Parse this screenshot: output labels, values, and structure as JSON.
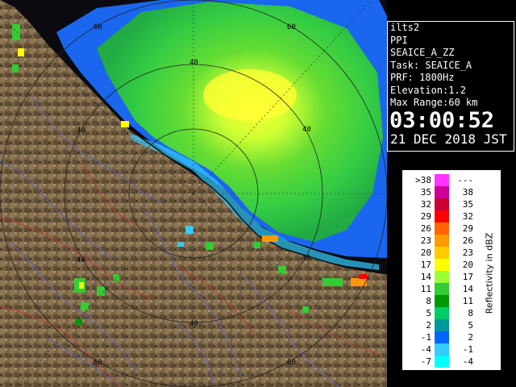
{
  "info": {
    "station": "ilts2",
    "mode": "PPI",
    "task_name": "SEAICE_A_ZZ",
    "task": "Task: SEAICE_A",
    "prf": "PRF: 1800Hz",
    "elevation": "Elevation:1.2",
    "max_range": "Max Range:60 km",
    "time": "03:00:52",
    "date": "21 DEC 2018 JST"
  },
  "range_ring_labels": {
    "r40": "40",
    "r60": "60"
  },
  "legend": {
    "title": "Reflectivity in dBZ",
    "bins": [
      {
        "lo": ">38",
        "hi": "---",
        "color": "#ff33ff"
      },
      {
        "lo": "35",
        "hi": "38",
        "color": "#cc0099"
      },
      {
        "lo": "32",
        "hi": "35",
        "color": "#cc0033"
      },
      {
        "lo": "29",
        "hi": "32",
        "color": "#ff0000"
      },
      {
        "lo": "26",
        "hi": "29",
        "color": "#ff6600"
      },
      {
        "lo": "23",
        "hi": "26",
        "color": "#ff9900"
      },
      {
        "lo": "20",
        "hi": "23",
        "color": "#ffcc00"
      },
      {
        "lo": "17",
        "hi": "20",
        "color": "#ffff00"
      },
      {
        "lo": "14",
        "hi": "17",
        "color": "#99ff33"
      },
      {
        "lo": "11",
        "hi": "14",
        "color": "#33cc33"
      },
      {
        "lo": "8",
        "hi": "11",
        "color": "#009900"
      },
      {
        "lo": "5",
        "hi": "8",
        "color": "#00cc66"
      },
      {
        "lo": "2",
        "hi": "5",
        "color": "#009999"
      },
      {
        "lo": "-1",
        "hi": "2",
        "color": "#0066ff"
      },
      {
        "lo": "-4",
        "hi": "-1",
        "color": "#33ccff"
      },
      {
        "lo": "-7",
        "hi": "-4",
        "color": "#00ffff"
      }
    ]
  }
}
